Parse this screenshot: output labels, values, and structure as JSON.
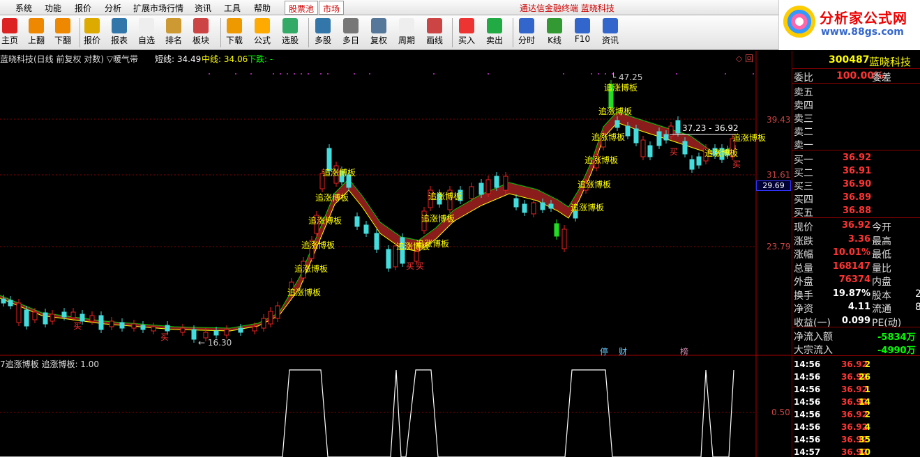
{
  "menu": {
    "items": [
      "系统",
      "功能",
      "报价",
      "分析",
      "扩展市场行情",
      "资讯",
      "工具",
      "帮助"
    ],
    "tab_gupiao": "股票池",
    "tab_market": "市场",
    "title": "通达信金融终端  蓝晓科技"
  },
  "toolbar": {
    "buttons": [
      "主页",
      "上翻",
      "下翻",
      "报价",
      "报表",
      "自选",
      "排名",
      "板块",
      "下载",
      "公式",
      "选股",
      "多股",
      "多日",
      "复权",
      "周期",
      "画线",
      "买入",
      "卖出",
      "分时",
      "K线",
      "F10",
      "资讯"
    ],
    "icons": [
      "home-icon",
      "arrow-up-icon",
      "arrow-down-icon",
      "quote-icon",
      "report-icon",
      "f6-icon",
      "rank-icon",
      "sector-icon",
      "download-icon",
      "formula-icon",
      "select-icon",
      "multi-icon",
      "clock-icon",
      "adjust-icon",
      "f8-icon",
      "draw-icon",
      "buy-icon",
      "sell-icon",
      "minute-icon",
      "kline-icon",
      "f10-icon",
      "news-icon"
    ],
    "icon_colors": [
      "#d22",
      "#e80",
      "#e80",
      "#da0",
      "#37a",
      "#eee",
      "#c93",
      "#c44",
      "#e90",
      "#fa0",
      "#3a6",
      "#37a",
      "#777",
      "#579",
      "#eee",
      "#c44",
      "#e33",
      "#2a4",
      "#36c",
      "#393",
      "#36c",
      "#36c"
    ]
  },
  "logo": {
    "text1": "分析家公式网",
    "text2": "www.88gs.com"
  },
  "chart": {
    "info_left": "蓝晓科技(日线 前复权 对数) ▽暖气带",
    "short_label": "短线: 34.49",
    "mid_label": "中线: 34.06",
    "down_label": "下跌: -",
    "price_ticks": [
      "39.43",
      "31.61",
      "23.79"
    ],
    "cursor_price": "29.69",
    "indicator_title": "7追涨博板  追涨博板: 1.00",
    "indicator_tick": "0.50",
    "signal_text": "追涨博板",
    "buy_text": "买",
    "peak_label": "47.25",
    "low_label": "16.30",
    "range_label": "37.23 - 36.92",
    "event_labels": [
      "停",
      "财",
      "榜"
    ],
    "top_icons": "◇ 回"
  },
  "chart_data": {
    "type": "candlestick",
    "price_ticks": [
      39.43,
      31.61,
      23.79
    ],
    "high_label": 47.25,
    "low_label": 16.3,
    "signal_label": "追涨博板",
    "indicator_value": 1.0
  },
  "panel": {
    "code": "300487",
    "name": "蓝晓科技",
    "weibi_label": "委比",
    "weibi_value": "100.00%",
    "weicha_label": "委差",
    "sell_labels": [
      "卖五",
      "卖四",
      "卖三",
      "卖二",
      "卖一"
    ],
    "buys": [
      {
        "label": "买一",
        "price": "36.92"
      },
      {
        "label": "买二",
        "price": "36.91"
      },
      {
        "label": "买三",
        "price": "36.90"
      },
      {
        "label": "买四",
        "price": "36.89"
      },
      {
        "label": "买五",
        "price": "36.88"
      }
    ],
    "stats": [
      {
        "l1": "现价",
        "v1": "36.92",
        "l2": "今开"
      },
      {
        "l1": "涨跌",
        "v1": "3.36",
        "l2": "最高"
      },
      {
        "l1": "涨幅",
        "v1": "10.01%",
        "l2": "最低"
      },
      {
        "l1": "总量",
        "v1": "168147",
        "l2": "量比"
      },
      {
        "l1": "外盘",
        "v1": "76374",
        "l2": "内盘"
      },
      {
        "l1": "换手",
        "v1": "19.87%",
        "l2": "股本",
        "v2": "2"
      },
      {
        "l1": "净资",
        "v1": "4.11",
        "l2": "流通",
        "v2": "8"
      },
      {
        "l1": "收益(一)",
        "v1": "0.099",
        "l2": "PE(动)"
      }
    ],
    "flow": [
      {
        "label": "净流入额",
        "value": "-5834万"
      },
      {
        "label": "大宗流入",
        "value": "-4990万"
      }
    ],
    "ticks": [
      {
        "time": "14:56",
        "price": "36.92",
        "vol": "2"
      },
      {
        "time": "14:56",
        "price": "36.92",
        "vol": "26"
      },
      {
        "time": "14:56",
        "price": "36.92",
        "vol": "1"
      },
      {
        "time": "14:56",
        "price": "36.92",
        "vol": "14"
      },
      {
        "time": "14:56",
        "price": "36.92",
        "vol": "2"
      },
      {
        "time": "14:56",
        "price": "36.92",
        "vol": "4"
      },
      {
        "time": "14:56",
        "price": "36.92",
        "vol": "35"
      },
      {
        "time": "14:57",
        "price": "36.92",
        "vol": "10"
      }
    ]
  }
}
